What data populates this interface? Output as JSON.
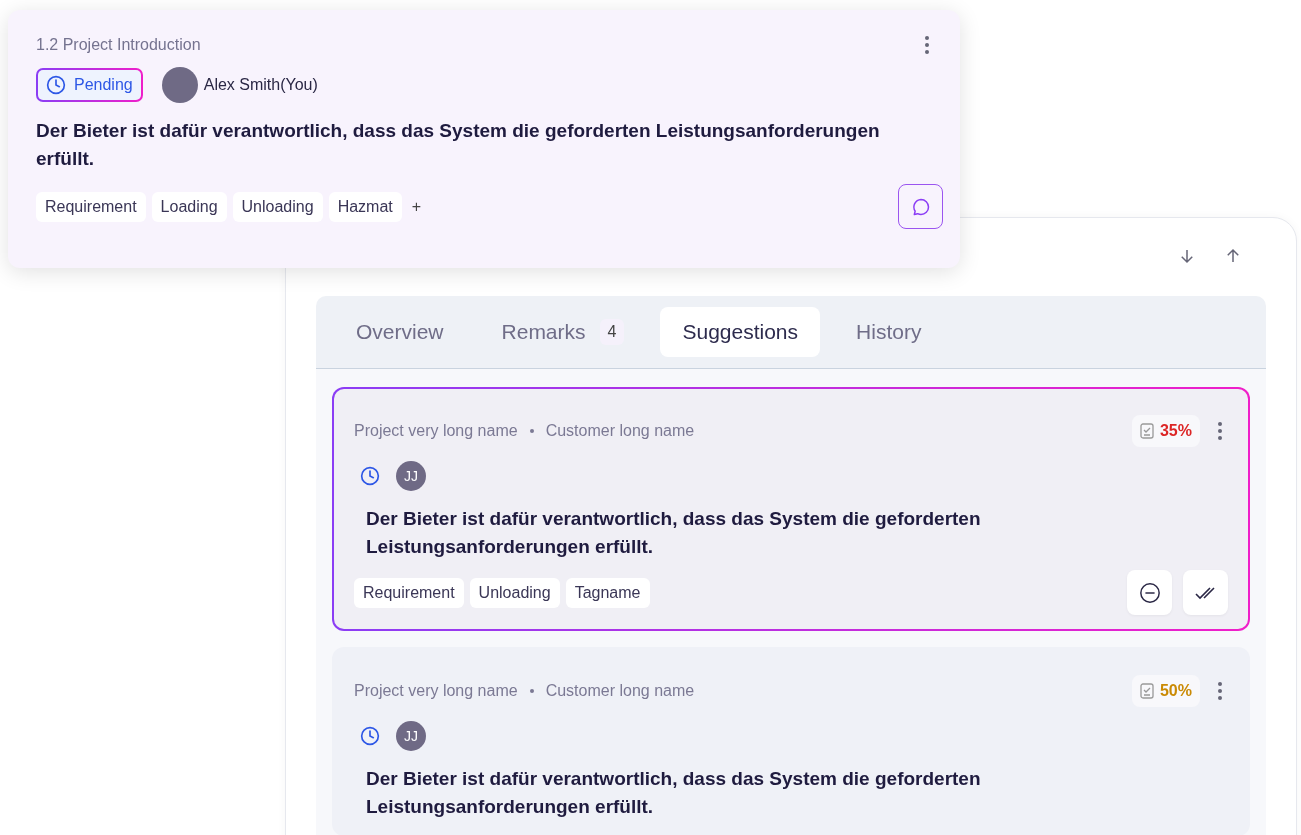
{
  "popup_card": {
    "section": "1.2 Project Introduction",
    "status": {
      "kind": "pending",
      "label": "Pending",
      "selected": true
    },
    "user": {
      "name": "Alex Smith(You)"
    },
    "text": "Der Bieter ist dafür verantwortlich, dass das System die geforderten Leistungsanforderungen erfüllt.",
    "tags": [
      "Requirement",
      "Loading",
      "Unloading",
      "Hazmat"
    ],
    "add_tag": "+"
  },
  "tabs": [
    {
      "label": "Overview",
      "selected": false
    },
    {
      "label": "Remarks",
      "count": "4",
      "selected": false
    },
    {
      "label": "Suggestions",
      "selected": true
    },
    {
      "label": "History",
      "selected": false
    }
  ],
  "suggestions": [
    {
      "project": "Project very long name",
      "customer": "Customer long name",
      "score": "35%",
      "color": "#dc2626",
      "avatar": "JJ",
      "selected": true,
      "text": "Der Bieter ist dafür verantwortlich, dass das System die geforderten Leistungsanforderungen erfüllt.",
      "tags": [
        "Requirement",
        "Unloading",
        "Tagname"
      ],
      "actions": true
    },
    {
      "project": "Project very long name",
      "customer": "Customer long name",
      "score": "50%",
      "color": "#ca8a04",
      "avatar": "JJ",
      "selected": false,
      "text": "Der Bieter ist dafür verantwortlich, dass das System die geforderten Leistungsanforderungen erfüllt.",
      "actions": false
    }
  ]
}
